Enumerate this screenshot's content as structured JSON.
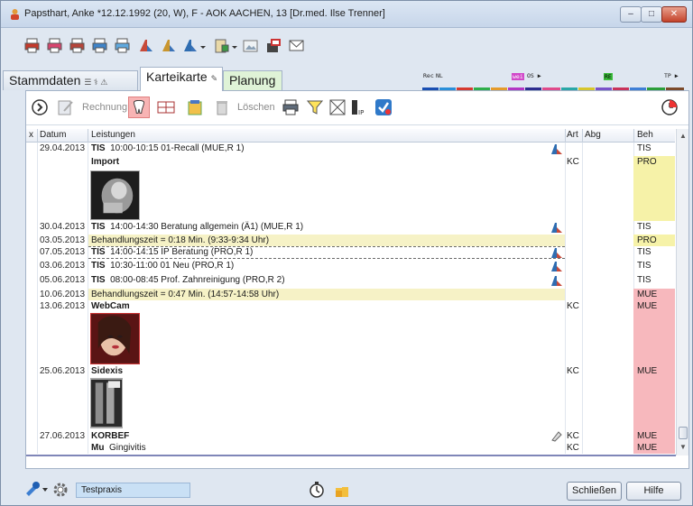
{
  "window": {
    "title": "Papsthart, Anke  *12.12.1992 (20, W),  F - AOK AACHEN, 13 [Dr.med. Ilse Trenner]",
    "minimize": "–",
    "maximize": "□",
    "close": "✕"
  },
  "tabs": [
    {
      "label": "Stammdaten"
    },
    {
      "label": "Karteikarte"
    },
    {
      "label": "Planung"
    }
  ],
  "legend": {
    "rec": "Rec",
    "nl": "NL",
    "wei": "wei",
    "os": "OS ▶",
    "re": "RE",
    "tp": "TP ▶"
  },
  "toolbar2": {
    "rechnung": "Rechnung",
    "loeschen": "Löschen"
  },
  "grid": {
    "headers": {
      "x": "x",
      "datum": "Datum",
      "leistungen": "Leistungen",
      "art": "Art",
      "abg": "Abg",
      "beh": "Beh"
    },
    "rows": [
      {
        "date": "29.04.2013",
        "code": "TIS",
        "text": "10:00-10:15 01-Recall (MUE,R 1)",
        "art": "",
        "beh": "TIS"
      },
      {
        "date": "",
        "code": "",
        "text": "Import",
        "art": "KC",
        "beh": "PRO"
      },
      {
        "date": "30.04.2013",
        "code": "TIS",
        "text": "14:00-14:30 Beratung allgemein (Ä1) (MUE,R 1)",
        "art": "",
        "beh": "TIS"
      },
      {
        "date": "03.05.2013",
        "code": "",
        "text": "Behandlungszeit = 0:18 Min. (9:33-9:34 Uhr)",
        "art": "",
        "beh": "PRO"
      },
      {
        "date": "07.05.2013",
        "code": "TIS",
        "text": "14:00-14:15 IP Beratung (PRO,R 1)",
        "art": "",
        "beh": "TIS"
      },
      {
        "date": "03.06.2013",
        "code": "TIS",
        "text": "10:30-11:00 01 Neu (PRO,R 1)",
        "art": "",
        "beh": "TIS"
      },
      {
        "date": "05.06.2013",
        "code": "TIS",
        "text": "08:00-08:45 Prof. Zahnreinigung (PRO,R 2)",
        "art": "",
        "beh": "TIS"
      },
      {
        "date": "10.06.2013",
        "code": "",
        "text": "Behandlungszeit = 0:47 Min. (14:57-14:58 Uhr)",
        "art": "",
        "beh": "MUE"
      },
      {
        "date": "13.06.2013",
        "code": "",
        "text": "WebCam",
        "art": "KC",
        "beh": "MUE"
      },
      {
        "date": "25.06.2013",
        "code": "",
        "text": "Sidexis",
        "art": "KC",
        "beh": "MUE"
      },
      {
        "date": "27.06.2013",
        "code": "",
        "text": "KORBEF",
        "art": "KC",
        "beh": "MUE"
      },
      {
        "date": "",
        "code": "Mu",
        "text": "Gingivitis",
        "art": "KC",
        "beh": "MUE"
      }
    ]
  },
  "status": {
    "praxis": "Testpraxis",
    "schliessen": "Schließen",
    "hilfe": "Hilfe"
  },
  "colors": {
    "pro": "#f6f2a8",
    "mue": "#f7b8bd",
    "highlight": "#f6f2c6",
    "accent": "#c9e0f5"
  }
}
